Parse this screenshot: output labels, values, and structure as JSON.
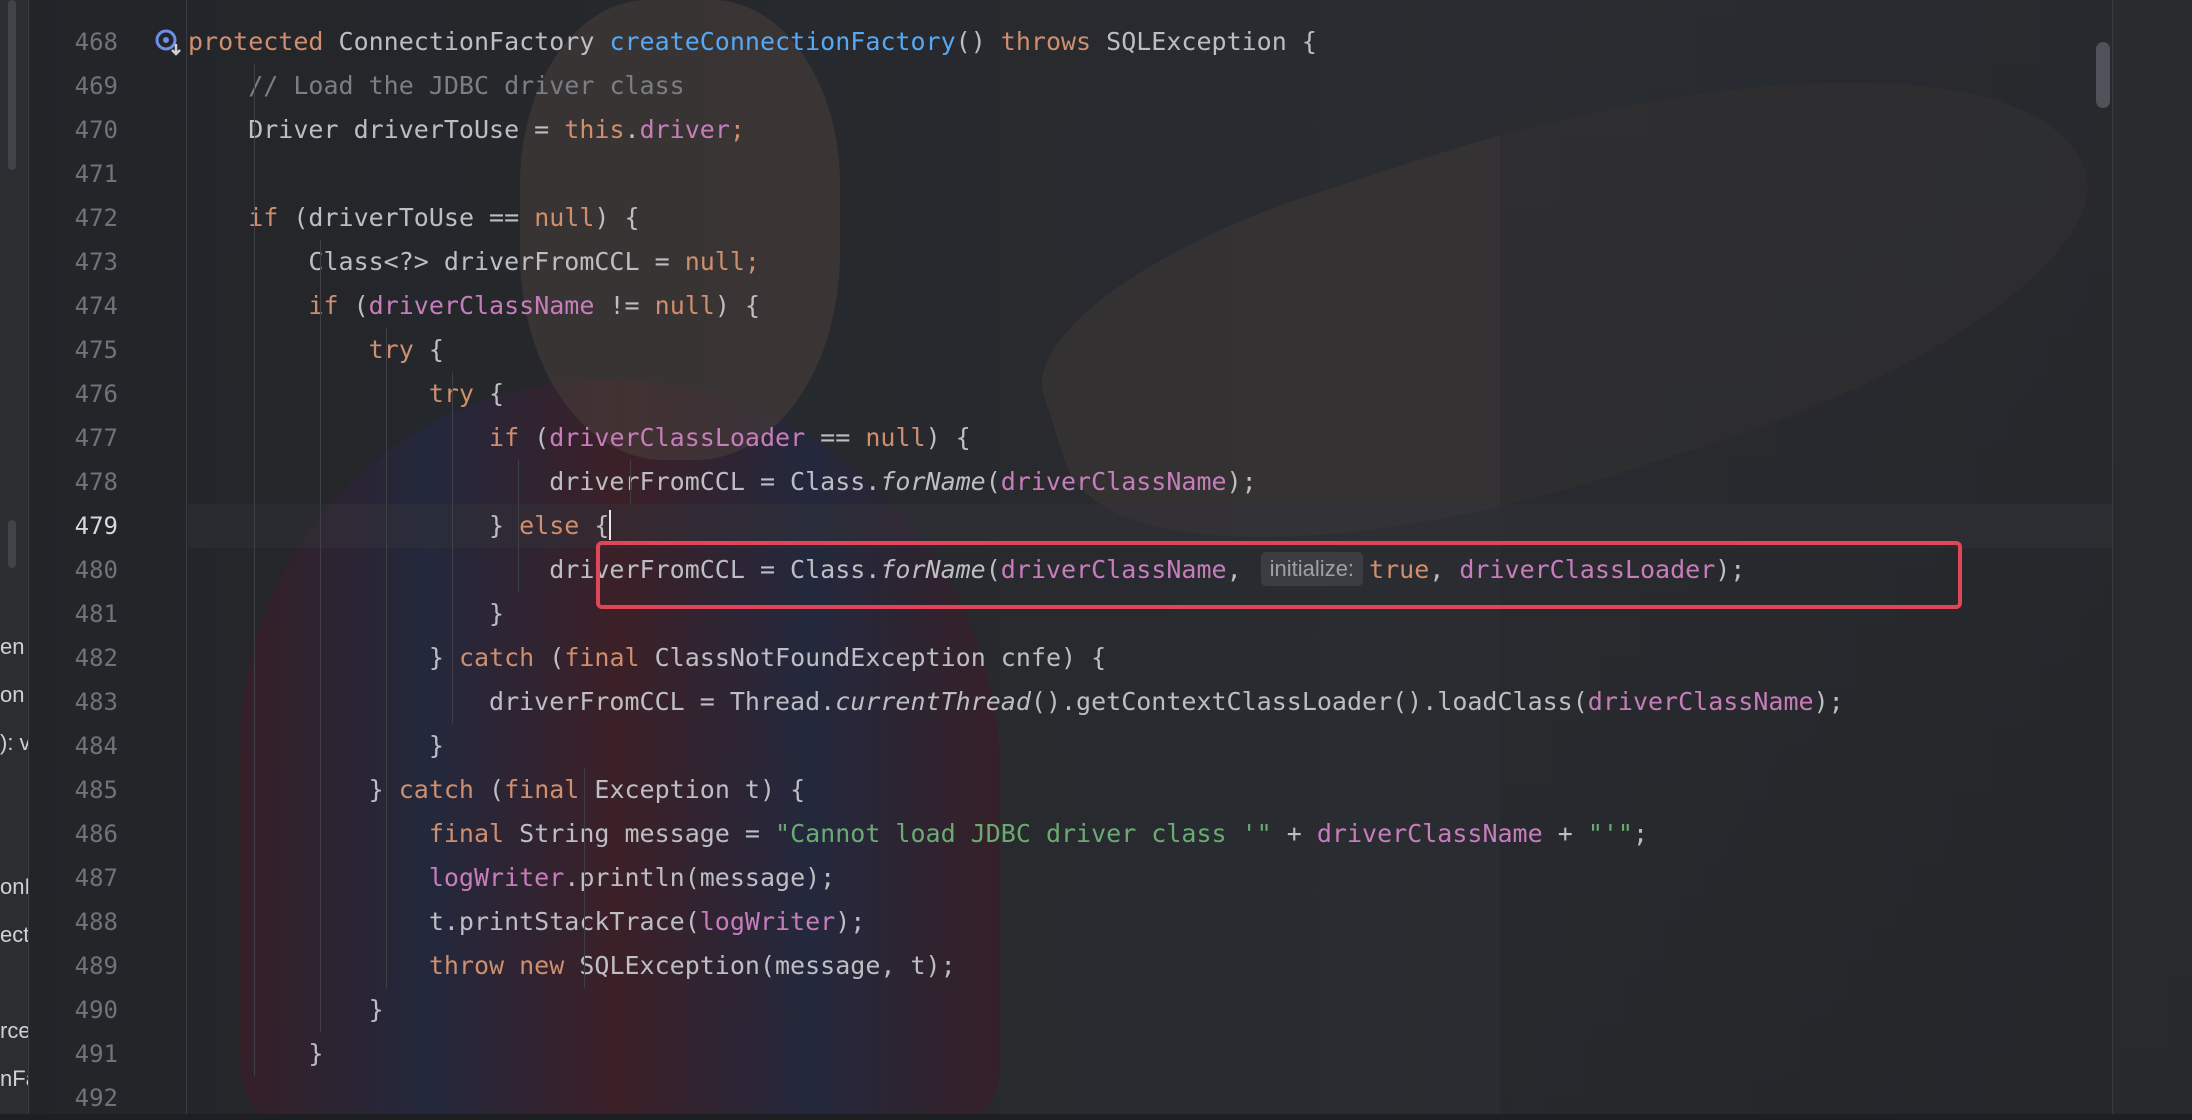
{
  "left_panel": {
    "fragments": [
      "en",
      "on",
      "): v",
      "onF",
      "ect",
      "rce",
      "nFa"
    ]
  },
  "gutter": {
    "line_numbers": [
      "468",
      "469",
      "470",
      "471",
      "472",
      "473",
      "474",
      "475",
      "476",
      "477",
      "478",
      "479",
      "480",
      "481",
      "482",
      "483",
      "484",
      "485",
      "486",
      "487",
      "488",
      "489",
      "490",
      "491",
      "492"
    ],
    "current_line": "479",
    "icon": "override-method-icon"
  },
  "code": {
    "lines": [
      [
        {
          "t": "protected ",
          "c": "kw"
        },
        {
          "t": "ConnectionFactory "
        },
        {
          "t": "createConnectionFactory",
          "c": "fn"
        },
        {
          "t": "() "
        },
        {
          "t": "throws ",
          "c": "kw"
        },
        {
          "t": "SQLException {"
        }
      ],
      [
        {
          "t": "    "
        },
        {
          "t": "// Load the JDBC driver class",
          "c": "cmt"
        }
      ],
      [
        {
          "t": "    Driver driverToUse = "
        },
        {
          "t": "this",
          "c": "kw"
        },
        {
          "t": "."
        },
        {
          "t": "driver",
          "c": "fld"
        },
        {
          "t": ";",
          "c": "kw"
        }
      ],
      [],
      [
        {
          "t": "    "
        },
        {
          "t": "if ",
          "c": "kw"
        },
        {
          "t": "(driverToUse == "
        },
        {
          "t": "null",
          "c": "kw"
        },
        {
          "t": ") {"
        }
      ],
      [
        {
          "t": "        Class<?> driverFromCCL = "
        },
        {
          "t": "null",
          "c": "kw"
        },
        {
          "t": ";",
          "c": "kw"
        }
      ],
      [
        {
          "t": "        "
        },
        {
          "t": "if ",
          "c": "kw"
        },
        {
          "t": "("
        },
        {
          "t": "driverClassName",
          "c": "fld"
        },
        {
          "t": " != "
        },
        {
          "t": "null",
          "c": "kw"
        },
        {
          "t": ") {"
        }
      ],
      [
        {
          "t": "            "
        },
        {
          "t": "try ",
          "c": "kw"
        },
        {
          "t": "{"
        }
      ],
      [
        {
          "t": "                "
        },
        {
          "t": "try ",
          "c": "kw"
        },
        {
          "t": "{"
        }
      ],
      [
        {
          "t": "                    "
        },
        {
          "t": "if ",
          "c": "kw"
        },
        {
          "t": "("
        },
        {
          "t": "driverClassLoader",
          "c": "fld"
        },
        {
          "t": " == "
        },
        {
          "t": "null",
          "c": "kw"
        },
        {
          "t": ") {"
        }
      ],
      [
        {
          "t": "                        driverFromCCL = Class."
        },
        {
          "t": "forName",
          "c": "it"
        },
        {
          "t": "("
        },
        {
          "t": "driverClassName",
          "c": "fld"
        },
        {
          "t": ");"
        }
      ],
      [
        {
          "t": "                    } "
        },
        {
          "t": "else ",
          "c": "kw"
        },
        {
          "t": "{"
        },
        {
          "caret": true
        }
      ],
      [
        {
          "t": "                        driverFromCCL = Class."
        },
        {
          "t": "forName",
          "c": "it"
        },
        {
          "t": "("
        },
        {
          "t": "driverClassName",
          "c": "fld"
        },
        {
          "t": ", "
        },
        {
          "hint": "initialize:"
        },
        {
          "t": "true",
          "c": "kw"
        },
        {
          "t": ", "
        },
        {
          "t": "driverClassLoader",
          "c": "fld"
        },
        {
          "t": ");"
        }
      ],
      [
        {
          "t": "                    }"
        }
      ],
      [
        {
          "t": "                } "
        },
        {
          "t": "catch ",
          "c": "kw"
        },
        {
          "t": "("
        },
        {
          "t": "final ",
          "c": "kw"
        },
        {
          "t": "ClassNotFoundException cnfe) {"
        }
      ],
      [
        {
          "t": "                    driverFromCCL = Thread."
        },
        {
          "t": "currentThread",
          "c": "it"
        },
        {
          "t": "().getContextClassLoader().loadClass("
        },
        {
          "t": "driverClassName",
          "c": "fld"
        },
        {
          "t": ");"
        }
      ],
      [
        {
          "t": "                }"
        }
      ],
      [
        {
          "t": "            } "
        },
        {
          "t": "catch ",
          "c": "kw"
        },
        {
          "t": "("
        },
        {
          "t": "final ",
          "c": "kw"
        },
        {
          "t": "Exception t) {"
        }
      ],
      [
        {
          "t": "                "
        },
        {
          "t": "final ",
          "c": "kw"
        },
        {
          "t": "String message = "
        },
        {
          "t": "\"Cannot load JDBC driver class '\"",
          "c": "str"
        },
        {
          "t": " + "
        },
        {
          "t": "driverClassName",
          "c": "fld"
        },
        {
          "t": " + "
        },
        {
          "t": "\"'\"",
          "c": "str"
        },
        {
          "t": ";"
        }
      ],
      [
        {
          "t": "                "
        },
        {
          "t": "logWriter",
          "c": "fld"
        },
        {
          "t": ".println(message);"
        }
      ],
      [
        {
          "t": "                t.printStackTrace("
        },
        {
          "t": "logWriter",
          "c": "fld"
        },
        {
          "t": ");"
        }
      ],
      [
        {
          "t": "                "
        },
        {
          "t": "throw new ",
          "c": "kw"
        },
        {
          "t": "SQLException(message, t);"
        }
      ],
      [
        {
          "t": "            }"
        }
      ],
      [
        {
          "t": "        }"
        }
      ],
      []
    ]
  },
  "colors": {
    "keyword": "#cf8e6d",
    "method": "#56a8f5",
    "field": "#c77dbb",
    "comment": "#7a7e85",
    "string": "#6aab73",
    "highlight_box": "#e0455a"
  }
}
